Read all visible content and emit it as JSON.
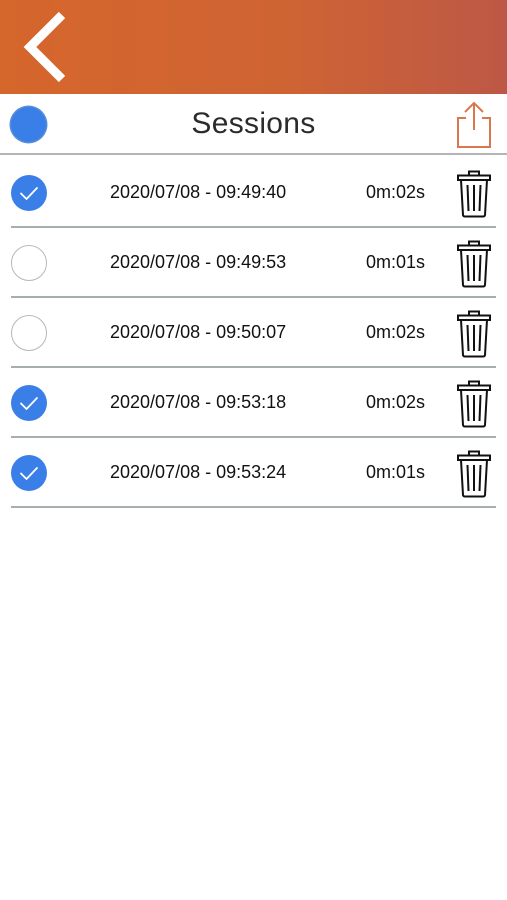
{
  "header": {
    "title": "Sessions",
    "back_icon": "chevron-left-icon",
    "share_icon": "share-icon",
    "select_all_checked": true
  },
  "colors": {
    "nav_gradient_start": "#d5662c",
    "nav_gradient_end": "#bd5846",
    "accent": "#3a7ee8",
    "share_icon": "#d9784f"
  },
  "sessions": [
    {
      "date": "2020/07/08 - 09:49:40",
      "duration": "0m:02s",
      "checked": true
    },
    {
      "date": "2020/07/08 - 09:49:53",
      "duration": "0m:01s",
      "checked": false
    },
    {
      "date": "2020/07/08 - 09:50:07",
      "duration": "0m:02s",
      "checked": false
    },
    {
      "date": "2020/07/08 - 09:53:18",
      "duration": "0m:02s",
      "checked": true
    },
    {
      "date": "2020/07/08 - 09:53:24",
      "duration": "0m:01s",
      "checked": true
    }
  ],
  "row_icons": {
    "delete_icon": "trash-icon"
  }
}
